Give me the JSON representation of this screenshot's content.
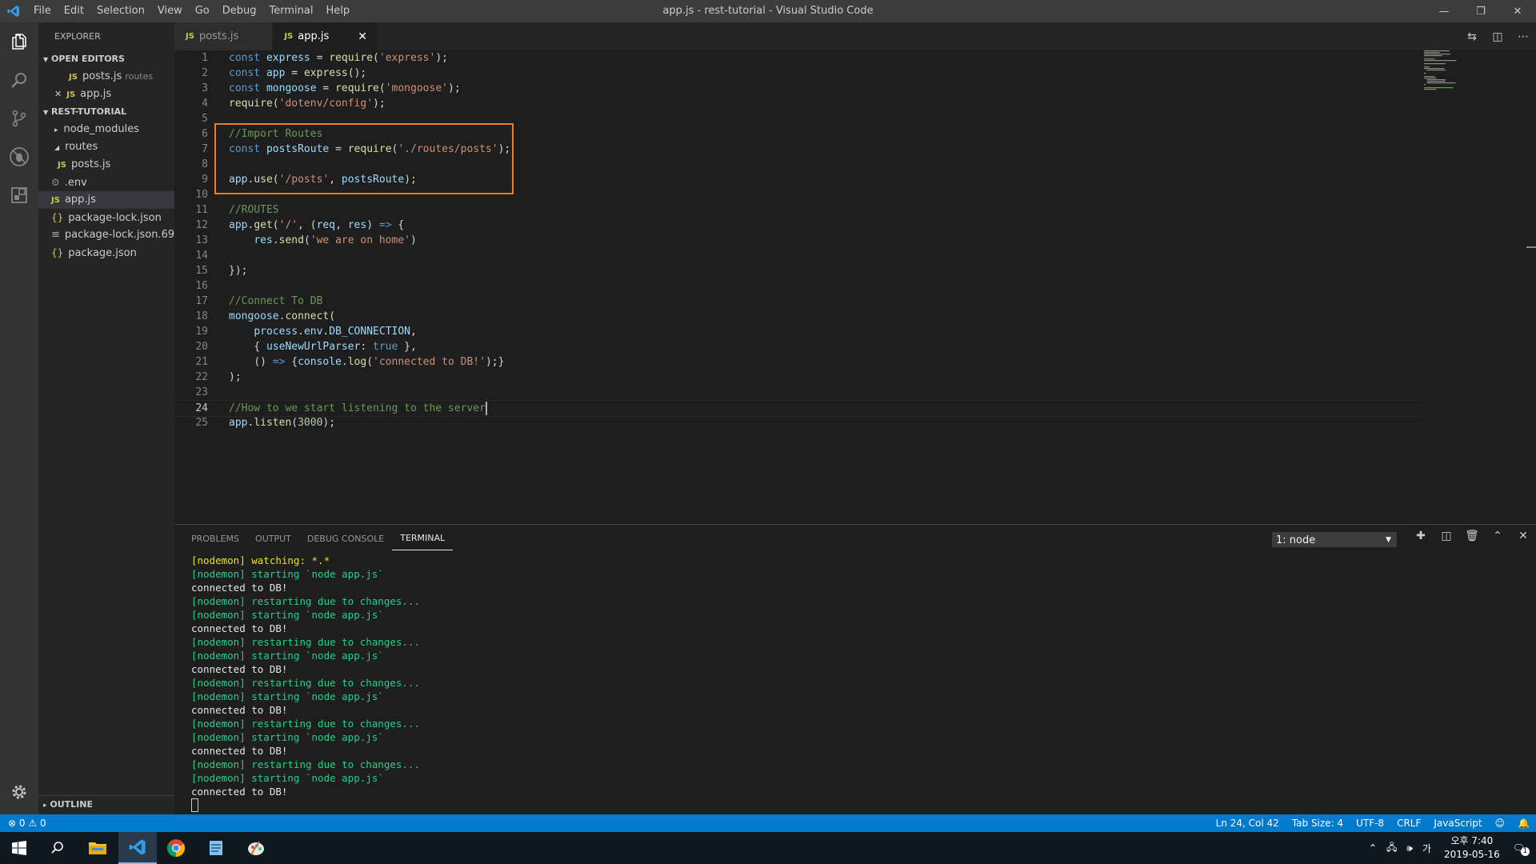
{
  "titlebar": {
    "title": "app.js - rest-tutorial - Visual Studio Code",
    "menu": [
      "File",
      "Edit",
      "Selection",
      "View",
      "Go",
      "Debug",
      "Terminal",
      "Help"
    ]
  },
  "activity_bar": {
    "items": [
      "explorer-icon",
      "search-icon",
      "source-control-icon",
      "debug-icon",
      "extensions-icon"
    ],
    "bottom": "gear-icon"
  },
  "sidebar": {
    "header": "EXPLORER",
    "open_editors": {
      "title": "OPEN EDITORS",
      "items": [
        {
          "name": "posts.js",
          "desc": "routes"
        },
        {
          "name": "app.js",
          "desc": ""
        }
      ]
    },
    "project": {
      "title": "REST-TUTORIAL",
      "items": [
        {
          "name": "node_modules"
        },
        {
          "name": "routes"
        },
        {
          "name": "posts.js"
        },
        {
          "name": ".env"
        },
        {
          "name": "app.js"
        },
        {
          "name": "package-lock.json"
        },
        {
          "name": "package-lock.json.69..."
        },
        {
          "name": "package.json"
        }
      ]
    },
    "outline": "OUTLINE"
  },
  "tabs": [
    {
      "label": "posts.js",
      "active": false
    },
    {
      "label": "app.js",
      "active": true
    }
  ],
  "editor": {
    "lines": [
      "const express = require('express');",
      "const app = express();",
      "const mongoose = require('mongoose');",
      "require('dotenv/config');",
      "",
      "//Import Routes",
      "const postsRoute = require('./routes/posts');",
      "",
      "app.use('/posts', postsRoute);",
      "",
      "//ROUTES",
      "app.get('/', (req, res) => {",
      "    res.send('we are on home')",
      "",
      "});",
      "",
      "//Connect To DB",
      "mongoose.connect(",
      "    process.env.DB_CONNECTION,",
      "    { useNewUrlParser: true },",
      "    () => {console.log('connected to DB!');}",
      ");",
      "",
      "//How to we start listening to the server",
      "app.listen(3000);"
    ],
    "current_line": 24
  },
  "panel": {
    "tabs": [
      "PROBLEMS",
      "OUTPUT",
      "DEBUG CONSOLE",
      "TERMINAL"
    ],
    "active_tab": "TERMINAL",
    "terminal_select": "1: node",
    "terminal_lines": [
      {
        "text": "[nodemon] watching: *.*",
        "color": "#e5e510"
      },
      {
        "text": "[nodemon] starting `node app.js`",
        "color": "#23d18b"
      },
      {
        "text": "connected to DB!",
        "color": "#e5e5e5"
      },
      {
        "text": "[nodemon] restarting due to changes...",
        "color": "#23d18b"
      },
      {
        "text": "[nodemon] starting `node app.js`",
        "color": "#23d18b"
      },
      {
        "text": "connected to DB!",
        "color": "#e5e5e5"
      },
      {
        "text": "[nodemon] restarting due to changes...",
        "color": "#23d18b"
      },
      {
        "text": "[nodemon] starting `node app.js`",
        "color": "#23d18b"
      },
      {
        "text": "connected to DB!",
        "color": "#e5e5e5"
      },
      {
        "text": "[nodemon] restarting due to changes...",
        "color": "#23d18b"
      },
      {
        "text": "[nodemon] starting `node app.js`",
        "color": "#23d18b"
      },
      {
        "text": "connected to DB!",
        "color": "#e5e5e5"
      },
      {
        "text": "[nodemon] restarting due to changes...",
        "color": "#23d18b"
      },
      {
        "text": "[nodemon] starting `node app.js`",
        "color": "#23d18b"
      },
      {
        "text": "connected to DB!",
        "color": "#e5e5e5"
      },
      {
        "text": "[nodemon] restarting due to changes...",
        "color": "#23d18b"
      },
      {
        "text": "[nodemon] starting `node app.js`",
        "color": "#23d18b"
      },
      {
        "text": "connected to DB!",
        "color": "#e5e5e5"
      }
    ]
  },
  "statusbar": {
    "errors": "0",
    "warnings": "0",
    "position": "Ln 24, Col 42",
    "tab_size": "Tab Size: 4",
    "encoding": "UTF-8",
    "eol": "CRLF",
    "language": "JavaScript"
  },
  "taskbar": {
    "clock_time": "오후 7:40",
    "clock_date": "2019-05-16",
    "ime": "가",
    "notifications": "1"
  },
  "colors": {
    "accent": "#007acc",
    "highlight_box": "#f07d1e"
  }
}
